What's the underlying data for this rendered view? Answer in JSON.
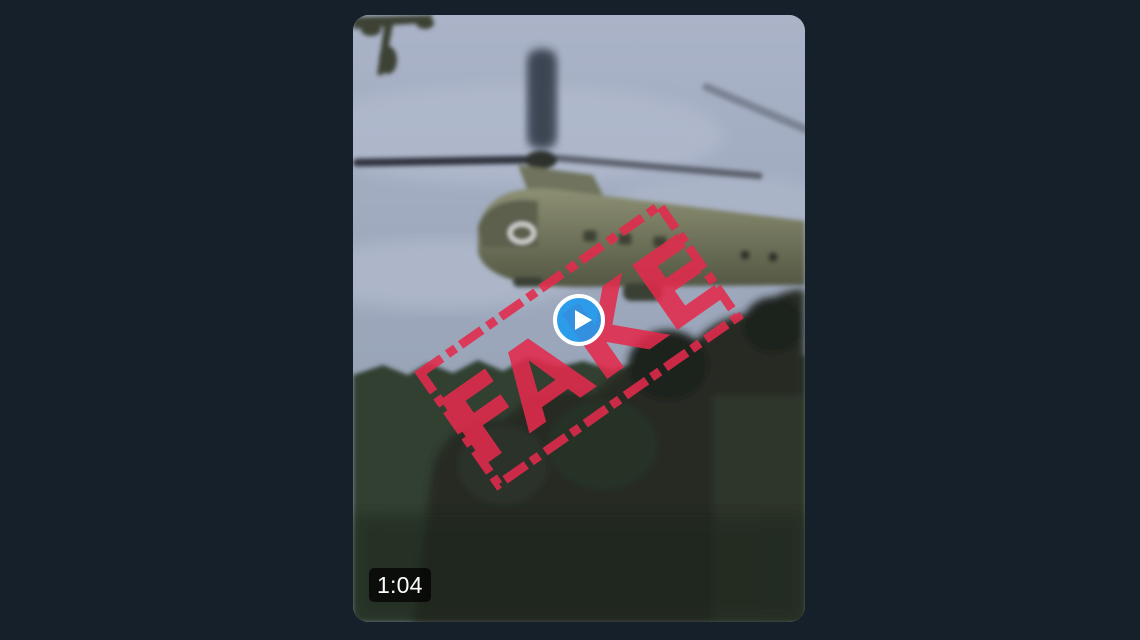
{
  "video": {
    "duration": "1:04",
    "stamp_text": "FAKE"
  },
  "icons": {
    "play": "play-icon"
  },
  "colors": {
    "page_background": "#15202b",
    "play_button": "#1d9bf0",
    "stamp": "#e32b4c"
  }
}
